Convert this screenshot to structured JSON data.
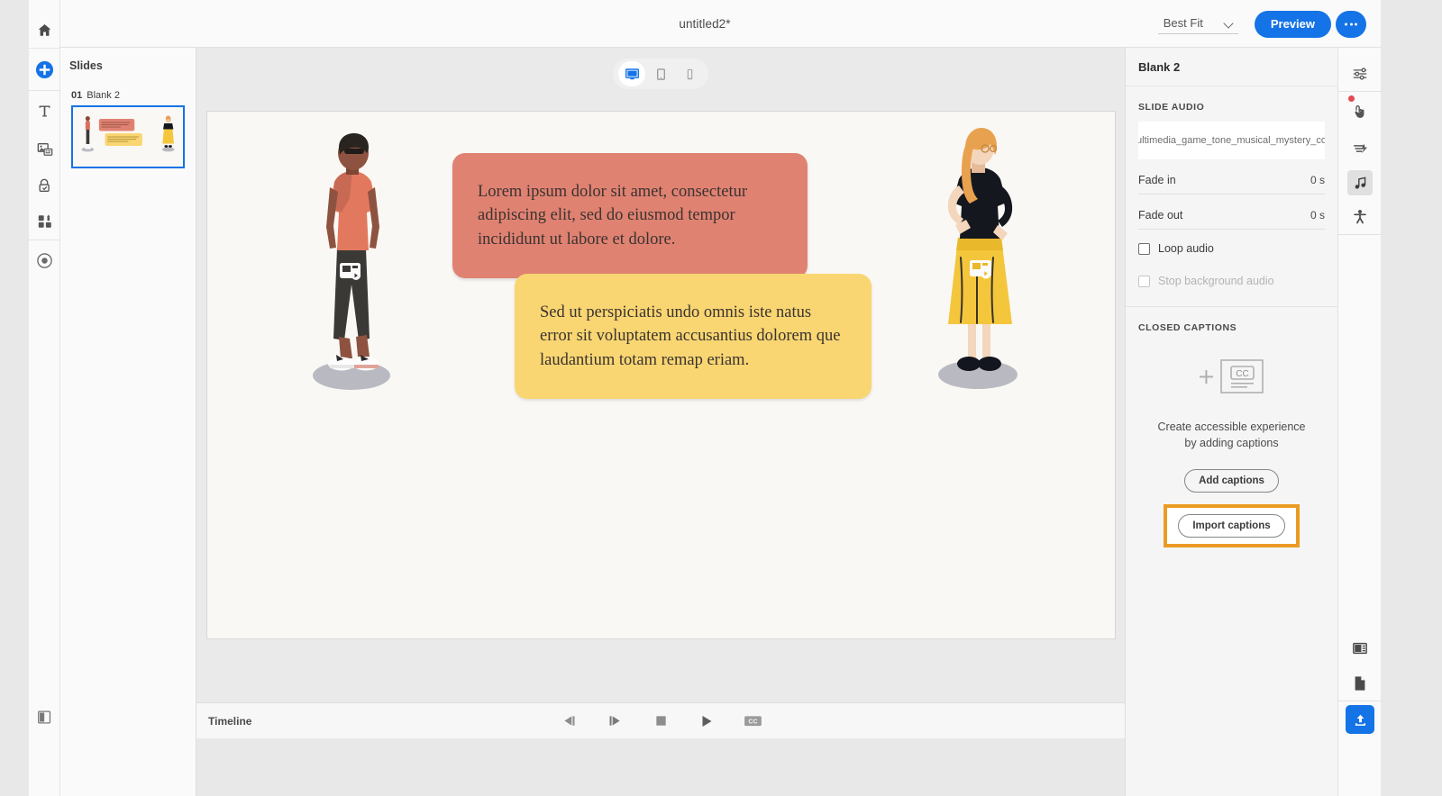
{
  "app": {
    "document_title": "untitled2*"
  },
  "topbar": {
    "zoom_value": "Best Fit",
    "preview_label": "Preview",
    "more_label": "•••"
  },
  "left_rail": {
    "items": [
      {
        "name": "home-icon",
        "tooltip": "Home"
      },
      {
        "name": "add-icon",
        "tooltip": "Add"
      },
      {
        "name": "text-icon",
        "tooltip": "Text"
      },
      {
        "name": "media-icon",
        "tooltip": "Media"
      },
      {
        "name": "interaction-icon",
        "tooltip": "Interactions"
      },
      {
        "name": "widgets-icon",
        "tooltip": "Widgets"
      },
      {
        "name": "record-icon",
        "tooltip": "Record"
      },
      {
        "name": "panel-toggle-icon",
        "tooltip": "Toggle panel"
      }
    ]
  },
  "slides": {
    "panel_title": "Slides",
    "items": [
      {
        "number": "01",
        "label": "Blank 2",
        "selected": true
      }
    ]
  },
  "devices": {
    "options": [
      {
        "name": "desktop-view",
        "label": "Desktop",
        "active": true
      },
      {
        "name": "tablet-view",
        "label": "Tablet",
        "active": false
      },
      {
        "name": "mobile-view",
        "label": "Mobile",
        "active": false
      }
    ]
  },
  "stage": {
    "background_color": "#faf8f4",
    "callouts": [
      {
        "id": "red",
        "color": "#e08272",
        "text": "Lorem ipsum dolor sit amet, consectetur adipiscing elit, sed do eiusmod tempor incididunt ut labore et dolore."
      },
      {
        "id": "yellow",
        "color": "#f9d672",
        "text": "Sed ut perspiciatis undo omnis iste natus error sit voluptatem accusantius dolorem que laudantium totam remap eriam."
      }
    ],
    "characters": [
      {
        "name": "character-left",
        "description": "Standing woman with coral top and dark trousers"
      },
      {
        "name": "character-right",
        "description": "Standing woman with black top and yellow skirt"
      }
    ]
  },
  "timeline": {
    "label": "Timeline",
    "controls": [
      {
        "name": "step-backward-button",
        "glyph": "◀│"
      },
      {
        "name": "step-forward-button",
        "glyph": "│▶"
      },
      {
        "name": "stop-button",
        "glyph": "■"
      },
      {
        "name": "play-button",
        "glyph": "▶"
      },
      {
        "name": "captions-toggle-button",
        "glyph": "CC"
      }
    ]
  },
  "properties": {
    "title": "Blank 2",
    "slide_audio": {
      "section_label": "SLIDE AUDIO",
      "file_name": "multimedia_game_tone_musical_mystery_co...",
      "fade_in_label": "Fade in",
      "fade_in_value": "0 s",
      "fade_out_label": "Fade out",
      "fade_out_value": "0 s",
      "loop_audio_label": "Loop audio",
      "loop_audio_checked": false,
      "stop_background_label": "Stop background audio",
      "stop_background_checked": false,
      "stop_background_disabled": true
    },
    "closed_captions": {
      "section_label": "CLOSED CAPTIONS",
      "empty_message": "Create accessible experience by adding captions",
      "add_label": "Add captions",
      "import_label": "Import captions",
      "highlight_color": "#eb9b23",
      "highlighted_item": "Import captions"
    }
  },
  "right_rail": {
    "items": [
      {
        "name": "properties-icon",
        "active": false,
        "badge": false
      },
      {
        "name": "interactions-icon",
        "active": false,
        "badge": true
      },
      {
        "name": "effects-icon",
        "active": false,
        "badge": false
      },
      {
        "name": "audio-icon",
        "active": true,
        "badge": false
      },
      {
        "name": "accessibility-icon",
        "active": false,
        "badge": false
      },
      {
        "name": "layout-panel-icon",
        "active": false,
        "badge": false
      },
      {
        "name": "document-icon",
        "active": false,
        "badge": false
      },
      {
        "name": "publish-icon",
        "active": false,
        "badge": false
      }
    ]
  },
  "colors": {
    "accent_blue": "#1473e6",
    "highlight_orange": "#eb9b23",
    "badge_red": "#e34850"
  }
}
